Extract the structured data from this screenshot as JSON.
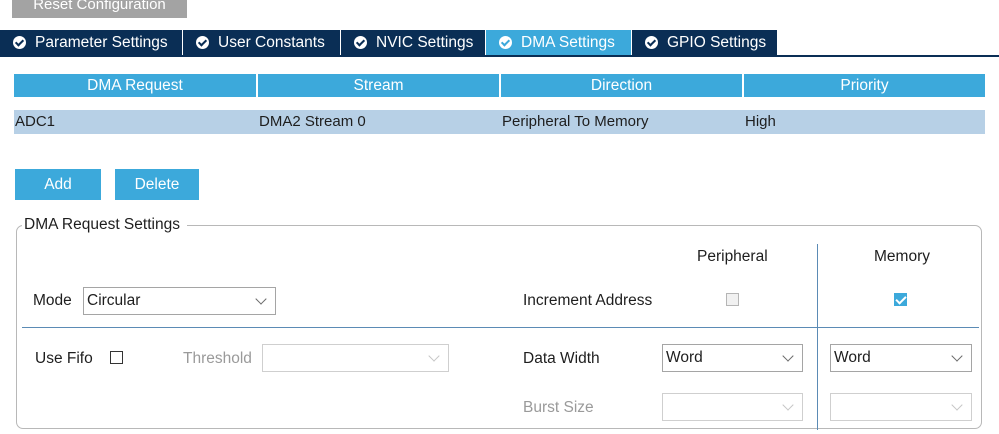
{
  "toolbar": {
    "reset_label": "Reset Configuration"
  },
  "tabs": [
    {
      "label": "Parameter Settings",
      "active": false
    },
    {
      "label": "User Constants",
      "active": false
    },
    {
      "label": "NVIC Settings",
      "active": false
    },
    {
      "label": "DMA Settings",
      "active": true
    },
    {
      "label": "GPIO Settings",
      "active": false
    }
  ],
  "table": {
    "columns": [
      "DMA Request",
      "Stream",
      "Direction",
      "Priority"
    ],
    "rows": [
      [
        "ADC1",
        "DMA2 Stream 0",
        "Peripheral To Memory",
        "High"
      ]
    ]
  },
  "actions": {
    "add_label": "Add",
    "delete_label": "Delete"
  },
  "settings": {
    "group_title": "DMA Request Settings",
    "peripheral_header": "Peripheral",
    "memory_header": "Memory",
    "mode_label": "Mode",
    "mode_value": "Circular",
    "increment_label": "Increment Address",
    "increment_peripheral": false,
    "increment_memory": true,
    "use_fifo_label": "Use Fifo",
    "use_fifo": false,
    "threshold_label": "Threshold",
    "threshold_value": "",
    "data_width_label": "Data Width",
    "data_width_peripheral": "Word",
    "data_width_memory": "Word",
    "burst_size_label": "Burst Size",
    "burst_peripheral": "",
    "burst_memory": ""
  },
  "colors": {
    "accent": "#3ca9db",
    "tab_inactive": "#0a2e55",
    "row_selected": "#b7d0e6",
    "reset_button": "#a3a3a3"
  }
}
